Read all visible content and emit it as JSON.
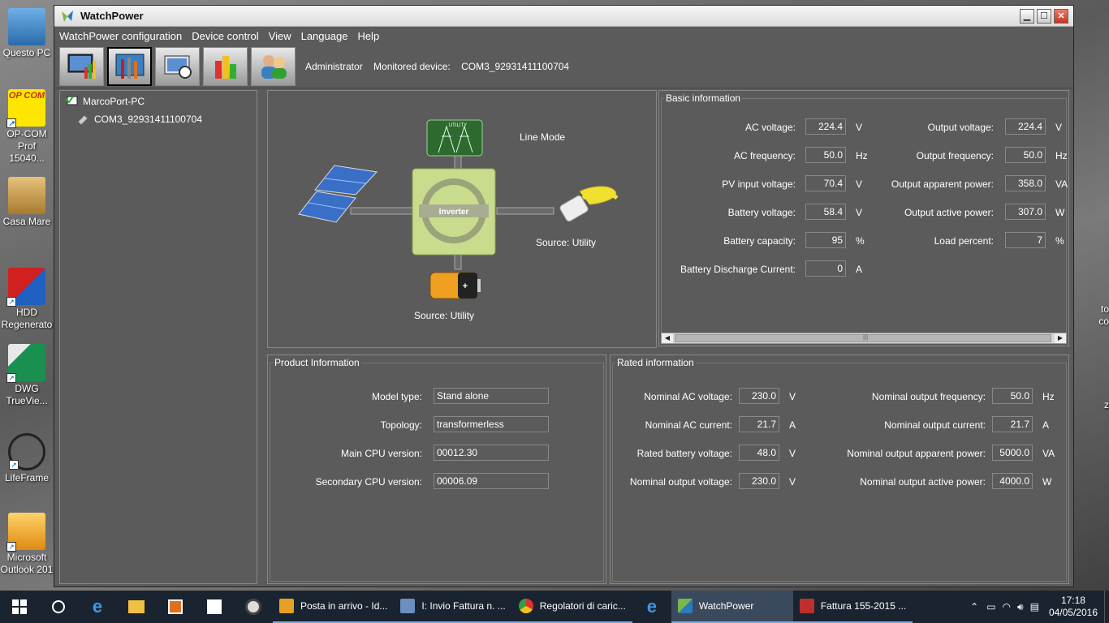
{
  "desktop": {
    "icons": [
      {
        "label": "Questo PC",
        "color": "#3a7fc0"
      },
      {
        "label": "OP-COM Prof 15040...",
        "color": "#ffe600"
      },
      {
        "label": "Casa Mare",
        "color": "#c99a44"
      },
      {
        "label": "HDD Regenerato",
        "color": "#c02020"
      },
      {
        "label": "DWG TrueVie...",
        "color": "#1a9050"
      },
      {
        "label": "LifeFrame",
        "color": "#222"
      },
      {
        "label": "Microsoft Outlook 201",
        "color": "#e8a020"
      }
    ],
    "right_fragments": [
      "to",
      "co",
      "z"
    ],
    "opcom_badge": "OP COM"
  },
  "window": {
    "title": "WatchPower",
    "menu": [
      "WatchPower configuration",
      "Device control",
      "View",
      "Language",
      "Help"
    ],
    "toolbar": {
      "user": "Administrator",
      "monitored_label": "Monitored device:",
      "monitored_value": "COM3_92931411100704"
    },
    "tree": {
      "root": "MarcoPort-PC",
      "child": "COM3_92931411100704"
    },
    "diagram": {
      "mode": "Line Mode",
      "utility_label": "UTILITY",
      "inverter_label": "Inverter",
      "output_source": "Source:  Utility",
      "battery_source": "Source:  Utility",
      "battery_symbol": "+"
    },
    "basic": {
      "title": "Basic information",
      "left": [
        {
          "label": "AC voltage:",
          "value": "224.4",
          "unit": "V"
        },
        {
          "label": "AC frequency:",
          "value": "50.0",
          "unit": "Hz"
        },
        {
          "label": "PV input voltage:",
          "value": "70.4",
          "unit": "V"
        },
        {
          "label": "Battery voltage:",
          "value": "58.4",
          "unit": "V"
        },
        {
          "label": "Battery capacity:",
          "value": "95",
          "unit": "%"
        },
        {
          "label": "Battery Discharge Current:",
          "value": "0",
          "unit": "A"
        }
      ],
      "right": [
        {
          "label": "Output voltage:",
          "value": "224.4",
          "unit": "V"
        },
        {
          "label": "Output frequency:",
          "value": "50.0",
          "unit": "Hz"
        },
        {
          "label": "Output apparent power:",
          "value": "358.0",
          "unit": "VA"
        },
        {
          "label": "Output active power:",
          "value": "307.0",
          "unit": "W"
        },
        {
          "label": "Load percent:",
          "value": "7",
          "unit": "%"
        }
      ],
      "scroll_grip": "|||"
    },
    "product": {
      "title": "Product Information",
      "rows": [
        {
          "label": "Model type:",
          "value": "Stand alone"
        },
        {
          "label": "Topology:",
          "value": "transformerless"
        },
        {
          "label": "Main CPU version:",
          "value": "00012.30"
        },
        {
          "label": "Secondary CPU version:",
          "value": "00006.09"
        }
      ]
    },
    "rated": {
      "title": "Rated information",
      "left": [
        {
          "label": "Nominal AC voltage:",
          "value": "230.0",
          "unit": "V"
        },
        {
          "label": "Nominal AC current:",
          "value": "21.7",
          "unit": "A"
        },
        {
          "label": "Rated battery voltage:",
          "value": "48.0",
          "unit": "V"
        },
        {
          "label": "Nominal output voltage:",
          "value": "230.0",
          "unit": "V"
        }
      ],
      "right": [
        {
          "label": "Nominal output frequency:",
          "value": "50.0",
          "unit": "Hz"
        },
        {
          "label": "Nominal output current:",
          "value": "21.7",
          "unit": "A"
        },
        {
          "label": "Nominal output apparent power:",
          "value": "5000.0",
          "unit": "VA"
        },
        {
          "label": "Nominal output active power:",
          "value": "4000.0",
          "unit": "W"
        }
      ]
    }
  },
  "taskbar": {
    "apps": [
      {
        "label": "Posta in arrivo - Id...",
        "color": "#e8a020"
      },
      {
        "label": "I: Invio Fattura n. ...",
        "color": "#6a8fc0"
      },
      {
        "label": "Regolatori di caric...",
        "color": "#4caf50"
      },
      {
        "label": "WatchPower",
        "color": "#7ab648"
      },
      {
        "label": "Fattura 155-2015 ...",
        "color": "#c0302a"
      }
    ],
    "time": "17:18",
    "date": "04/05/2016"
  }
}
